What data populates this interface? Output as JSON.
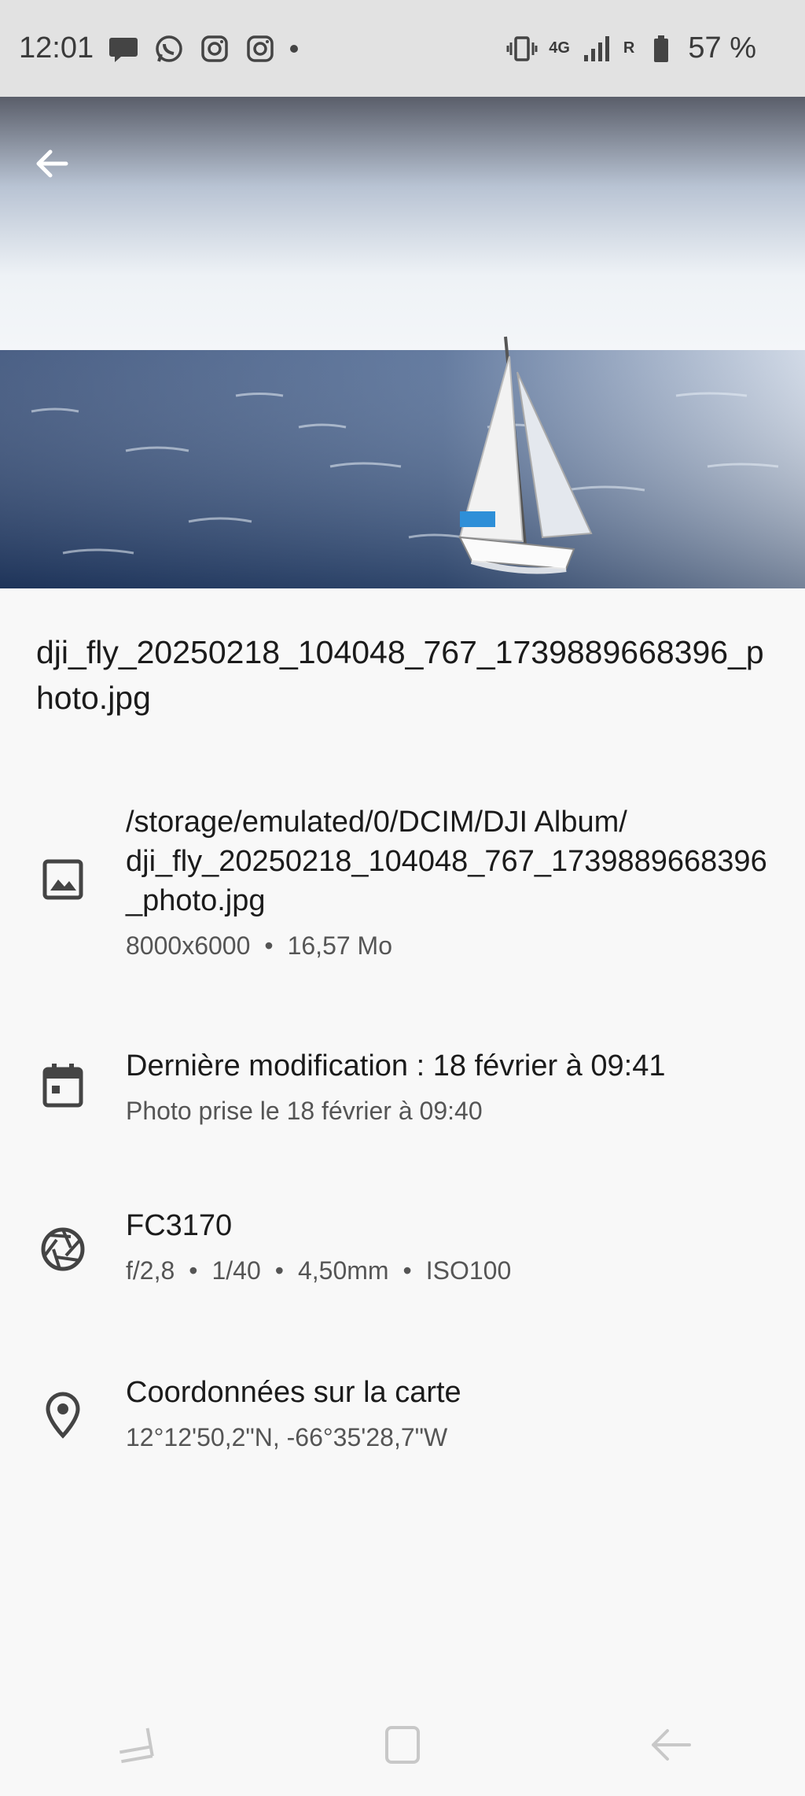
{
  "status_bar": {
    "time": "12:01",
    "network_label": "4G",
    "roaming": "R",
    "battery": "57 %"
  },
  "header": {
    "back_icon": "arrow-back-icon"
  },
  "file": {
    "name": "dji_fly_20250218_104048_767_1739889668396_photo.jpg"
  },
  "details": {
    "path": {
      "icon": "image-icon",
      "primary": "/storage/emulated/0/DCIM/DJI Album/\ndji_fly_20250218_104048_767_1739889668396_photo.jpg",
      "resolution": "8000x6000",
      "size": "16,57 Mo"
    },
    "date": {
      "icon": "calendar-icon",
      "primary": "Dernière modification : 18 février à 09:41",
      "secondary": "Photo prise le 18 février à 09:40"
    },
    "camera": {
      "icon": "aperture-icon",
      "model": "FC3170",
      "aperture": "f/2,8",
      "shutter": "1/40",
      "focal": "4,50mm",
      "iso": "ISO100"
    },
    "location": {
      "icon": "location-pin-icon",
      "primary": "Coordonnées sur la carte",
      "secondary": "12°12'50,2\"N, -66°35'28,7\"W"
    }
  },
  "nav": {
    "recents_icon": "recents-icon",
    "home_icon": "home-icon",
    "back_icon": "nav-back-icon"
  }
}
